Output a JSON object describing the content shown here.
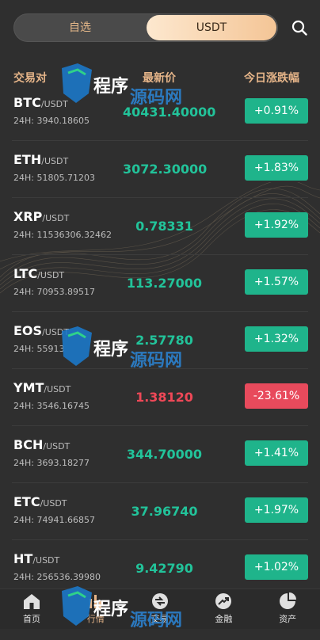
{
  "top": {
    "tabs": [
      "自选",
      "USDT"
    ],
    "active_tab": 1
  },
  "header": {
    "pair": "交易对",
    "price": "最新价",
    "change": "今日涨跌幅"
  },
  "rows": [
    {
      "base": "BTC",
      "quote": "/USDT",
      "vol": "24H: 3940.18605",
      "price": "40431.40000",
      "change": "+0.91%",
      "dir": "up"
    },
    {
      "base": "ETH",
      "quote": "/USDT",
      "vol": "24H: 51805.71203",
      "price": "3072.30000",
      "change": "+1.83%",
      "dir": "up"
    },
    {
      "base": "XRP",
      "quote": "/USDT",
      "vol": "24H: 11536306.32462",
      "price": "0.78331",
      "change": "+1.92%",
      "dir": "up"
    },
    {
      "base": "LTC",
      "quote": "/USDT",
      "vol": "24H: 70953.89517",
      "price": "113.27000",
      "change": "+1.57%",
      "dir": "up"
    },
    {
      "base": "EOS",
      "quote": "/USDT",
      "vol": "24H: 55913",
      "price": "2.57780",
      "change": "+1.32%",
      "dir": "up"
    },
    {
      "base": "YMT",
      "quote": "/USDT",
      "vol": "24H: 3546.16745",
      "price": "1.38120",
      "change": "-23.61%",
      "dir": "down"
    },
    {
      "base": "BCH",
      "quote": "/USDT",
      "vol": "24H: 3693.18277",
      "price": "344.70000",
      "change": "+1.41%",
      "dir": "up"
    },
    {
      "base": "ETC",
      "quote": "/USDT",
      "vol": "24H: 74941.66857",
      "price": "37.96740",
      "change": "+1.97%",
      "dir": "up"
    },
    {
      "base": "HT",
      "quote": "/USDT",
      "vol": "24H: 256536.39980",
      "price": "9.42790",
      "change": "+1.02%",
      "dir": "up"
    }
  ],
  "nav": [
    {
      "label": "首页",
      "icon": "home-icon"
    },
    {
      "label": "行情",
      "icon": "market-icon"
    },
    {
      "label": "交易",
      "icon": "trade-icon"
    },
    {
      "label": "金融",
      "icon": "finance-icon"
    },
    {
      "label": "资产",
      "icon": "assets-icon"
    }
  ],
  "nav_active": 1,
  "watermark": "程序源码网",
  "colors": {
    "up": "#1fb48b",
    "down": "#e84a5c",
    "accent": "#e6b589",
    "bg": "#2f2f2f"
  }
}
